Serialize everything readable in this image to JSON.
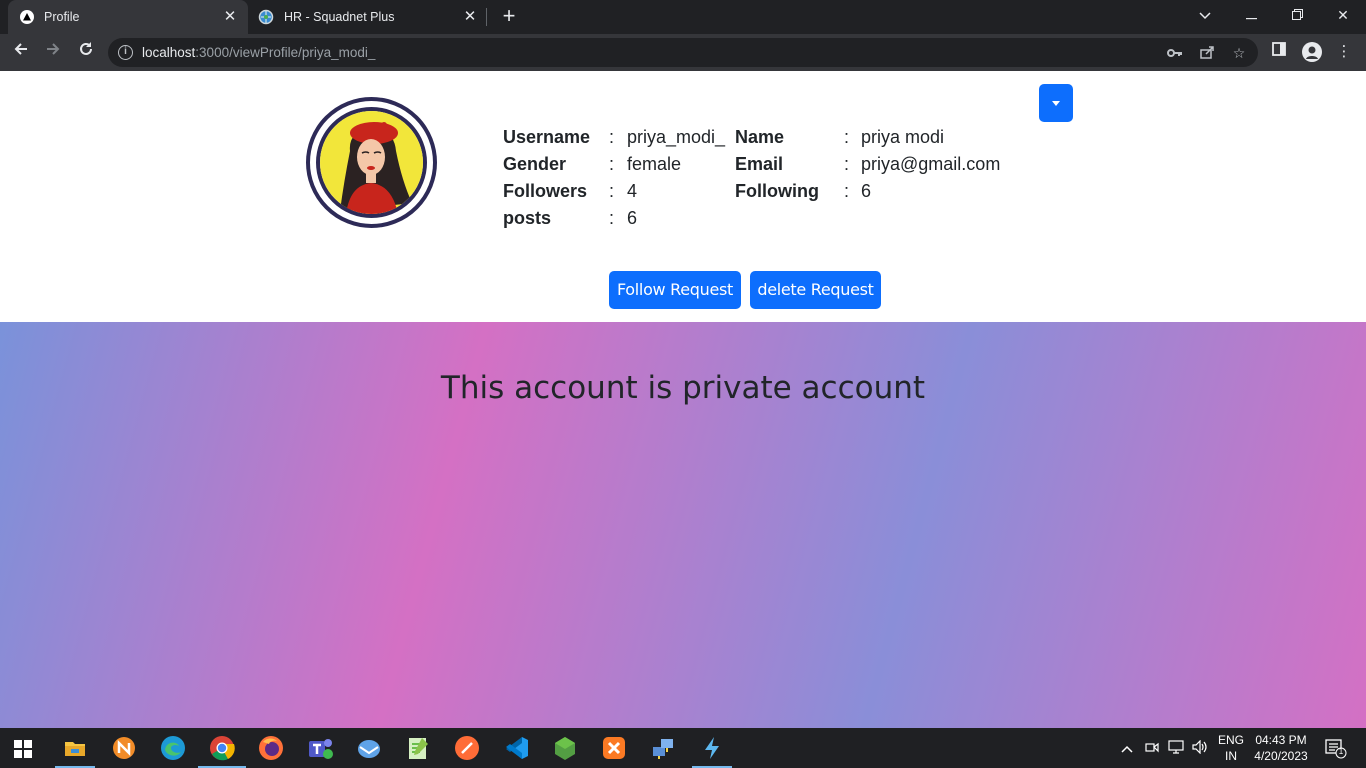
{
  "browser": {
    "tabs": [
      {
        "title": "Profile",
        "icon": "nextjs-triangle-icon",
        "active": true
      },
      {
        "title": "HR - Squadnet Plus",
        "icon": "squadnet-globe-icon",
        "active": false
      }
    ],
    "url_host": "localhost",
    "url_path": ":3000/viewProfile/priya_modi_"
  },
  "profile": {
    "fields": [
      {
        "label": "Username",
        "value": "priya_modi_"
      },
      {
        "label": "Name",
        "value": "priya modi"
      },
      {
        "label": "Gender",
        "value": "female"
      },
      {
        "label": "Email",
        "value": "priya@gmail.com"
      },
      {
        "label": "Followers",
        "value": "4"
      },
      {
        "label": "Following",
        "value": "6"
      },
      {
        "label": "posts",
        "value": "6"
      }
    ],
    "colon": ":",
    "follow_button": "Follow Request",
    "delete_button": "delete Request",
    "private_message": "This account is private account"
  },
  "colors": {
    "primary": "#0d6efd",
    "gradient_blue": "#7a92da",
    "gradient_pink": "#d470c4"
  },
  "taskbar": {
    "language": "ENG",
    "region": "IN",
    "time": "04:43 PM",
    "date": "4/20/2023",
    "notification_count": "1"
  }
}
